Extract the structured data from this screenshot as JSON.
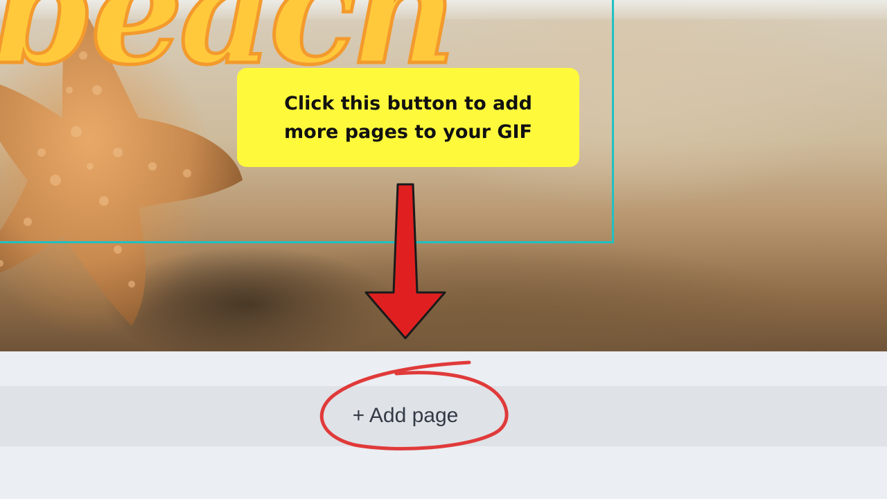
{
  "canvas": {
    "title": "beach",
    "accent_color": "#1fc1c3"
  },
  "callout": {
    "text": "Click this button to add more pages to your GIF",
    "background": "#fff93c"
  },
  "pages_bar": {
    "add_page_label": "+ Add page"
  },
  "annotations": {
    "arrow_color": "#e02020",
    "circle_color": "#e03a3a"
  }
}
